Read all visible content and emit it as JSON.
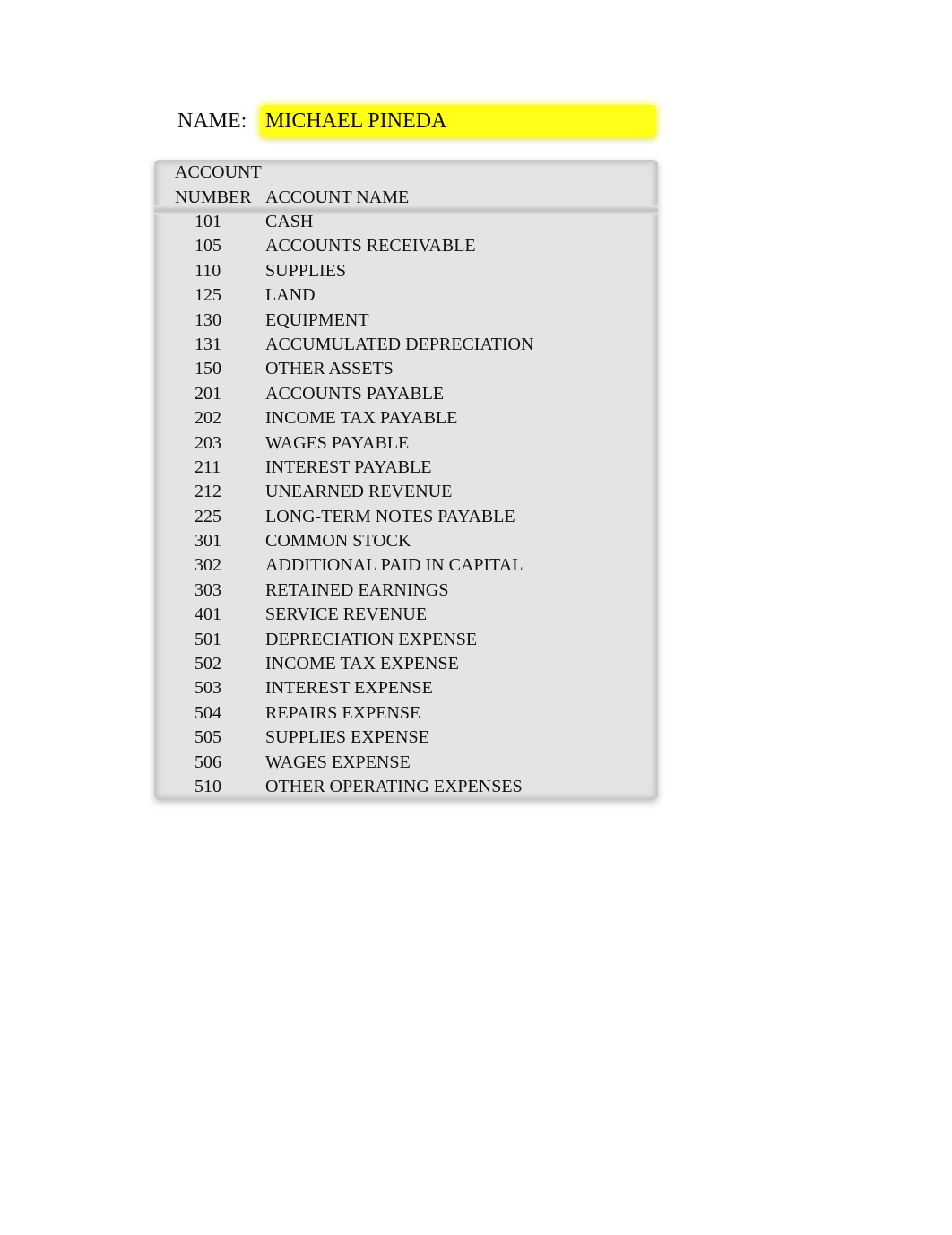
{
  "header": {
    "name_label": "NAME:",
    "name_value": "MICHAEL PINEDA",
    "highlight_color": "#ffff1a"
  },
  "table": {
    "col_number_line1": "ACCOUNT",
    "col_number_line2": "NUMBER",
    "col_name": "ACCOUNT NAME",
    "rows": [
      {
        "number": "101",
        "name": "CASH"
      },
      {
        "number": "105",
        "name": "ACCOUNTS RECEIVABLE"
      },
      {
        "number": "110",
        "name": "SUPPLIES"
      },
      {
        "number": "125",
        "name": "LAND"
      },
      {
        "number": "130",
        "name": "EQUIPMENT"
      },
      {
        "number": "131",
        "name": "ACCUMULATED DEPRECIATION"
      },
      {
        "number": "150",
        "name": "OTHER ASSETS"
      },
      {
        "number": "201",
        "name": "ACCOUNTS PAYABLE"
      },
      {
        "number": "202",
        "name": "INCOME TAX PAYABLE"
      },
      {
        "number": "203",
        "name": "WAGES PAYABLE"
      },
      {
        "number": "211",
        "name": "INTEREST PAYABLE"
      },
      {
        "number": "212",
        "name": "UNEARNED REVENUE"
      },
      {
        "number": "225",
        "name": "LONG-TERM NOTES PAYABLE"
      },
      {
        "number": "301",
        "name": "COMMON STOCK"
      },
      {
        "number": "302",
        "name": "ADDITIONAL PAID IN CAPITAL"
      },
      {
        "number": "303",
        "name": "RETAINED EARNINGS"
      },
      {
        "number": "401",
        "name": "SERVICE REVENUE"
      },
      {
        "number": "501",
        "name": "DEPRECIATION EXPENSE"
      },
      {
        "number": "502",
        "name": "INCOME TAX EXPENSE"
      },
      {
        "number": "503",
        "name": "INTEREST EXPENSE"
      },
      {
        "number": "504",
        "name": "REPAIRS EXPENSE"
      },
      {
        "number": "505",
        "name": "SUPPLIES EXPENSE"
      },
      {
        "number": "506",
        "name": "WAGES EXPENSE"
      },
      {
        "number": "510",
        "name": "OTHER OPERATING EXPENSES"
      }
    ]
  }
}
